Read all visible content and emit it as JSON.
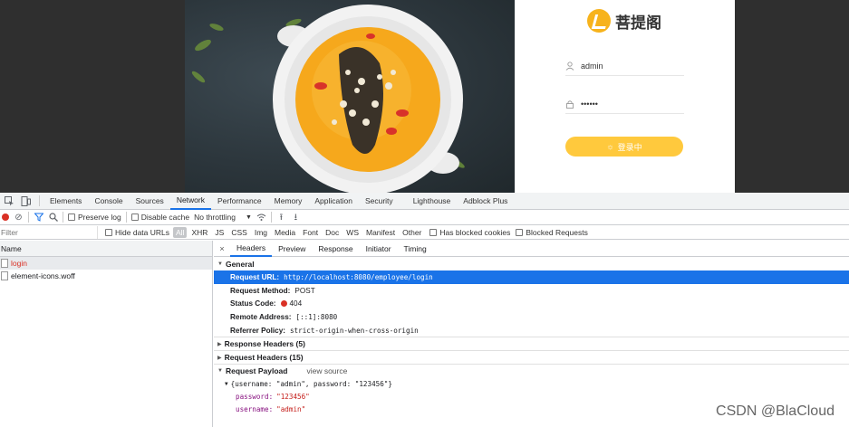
{
  "app": {
    "brand_name": "菩提阁",
    "username_value": "admin",
    "password_value": "••••••",
    "login_button_label": "登录中",
    "accent_color": "#ffc93d"
  },
  "devtools": {
    "tabs": [
      "Elements",
      "Console",
      "Sources",
      "Network",
      "Performance",
      "Memory",
      "Application",
      "Security",
      "Lighthouse",
      "Adblock Plus"
    ],
    "active_tab": "Network",
    "toolbar": {
      "preserve_log": "Preserve log",
      "disable_cache": "Disable cache",
      "throttling": "No throttling"
    },
    "filter": {
      "placeholder": "Filter",
      "hide_data_urls": "Hide data URLs",
      "types": [
        "All",
        "XHR",
        "JS",
        "CSS",
        "Img",
        "Media",
        "Font",
        "Doc",
        "WS",
        "Manifest",
        "Other"
      ],
      "has_blocked_cookies": "Has blocked cookies",
      "blocked_requests": "Blocked Requests"
    },
    "request_list": {
      "header": "Name",
      "rows": [
        {
          "name": "login",
          "status": "error"
        },
        {
          "name": "element-icons.woff",
          "status": "ok"
        }
      ]
    },
    "detail": {
      "close": "×",
      "tabs": [
        "Headers",
        "Preview",
        "Response",
        "Initiator",
        "Timing"
      ],
      "active_tab": "Headers",
      "general": {
        "title": "General",
        "request_url_label": "Request URL:",
        "request_url": "http://localhost:8080/employee/login",
        "request_method_label": "Request Method:",
        "request_method": "POST",
        "status_code_label": "Status Code:",
        "status_code": "404",
        "remote_address_label": "Remote Address:",
        "remote_address": "[::1]:8080",
        "referrer_policy_label": "Referrer Policy:",
        "referrer_policy": "strict-origin-when-cross-origin"
      },
      "response_headers": "Response Headers (5)",
      "request_headers": "Request Headers (15)",
      "payload": {
        "title": "Request Payload",
        "view_source": "view source",
        "root": "{username: \"admin\", password: \"123456\"}",
        "password_key": "password:",
        "password_value": "\"123456\"",
        "username_key": "username:",
        "username_value": "\"admin\""
      }
    }
  },
  "watermark": "CSDN @BlaCloud"
}
